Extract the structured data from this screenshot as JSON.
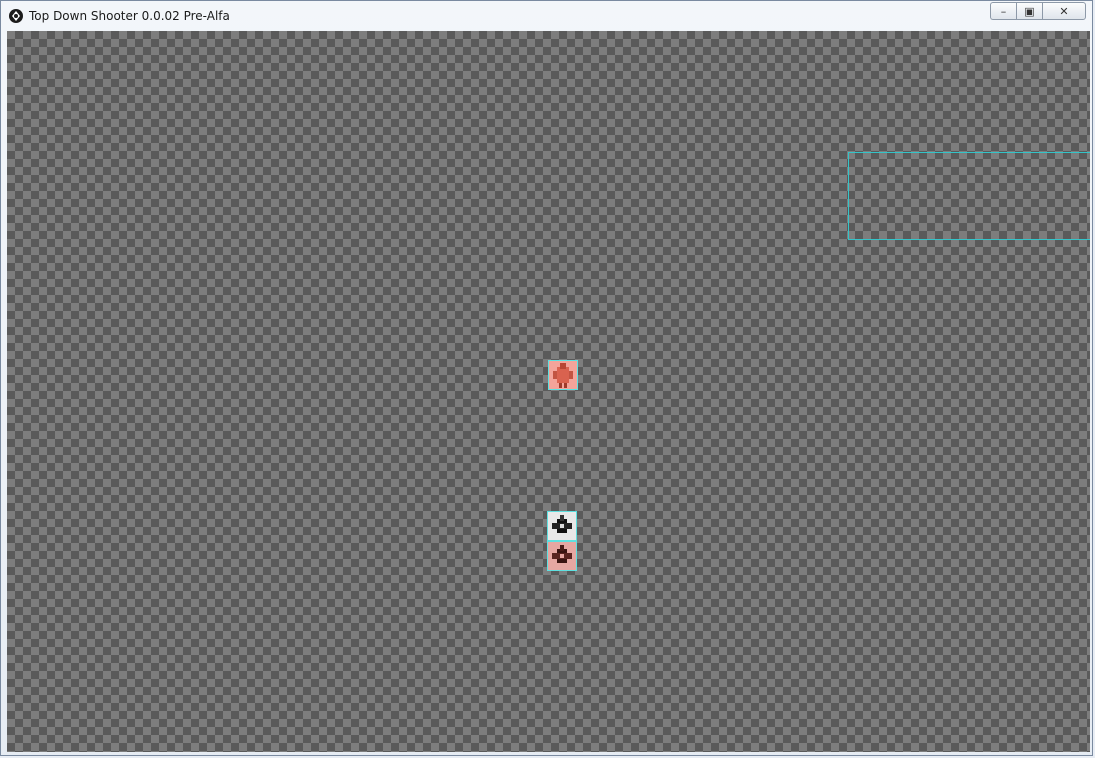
{
  "window": {
    "title": "Top Down Shooter 0.0.02 Pre-Alfa",
    "controls": {
      "minimize_symbol": "–",
      "maximize_symbol": "▣",
      "close_symbol": "✕"
    }
  },
  "colors": {
    "selection_outline": "#34c4c8",
    "sprite_outline": "#5ee0e0",
    "checker_light": "#7d7d7d",
    "checker_dark": "#5a5a5a"
  }
}
